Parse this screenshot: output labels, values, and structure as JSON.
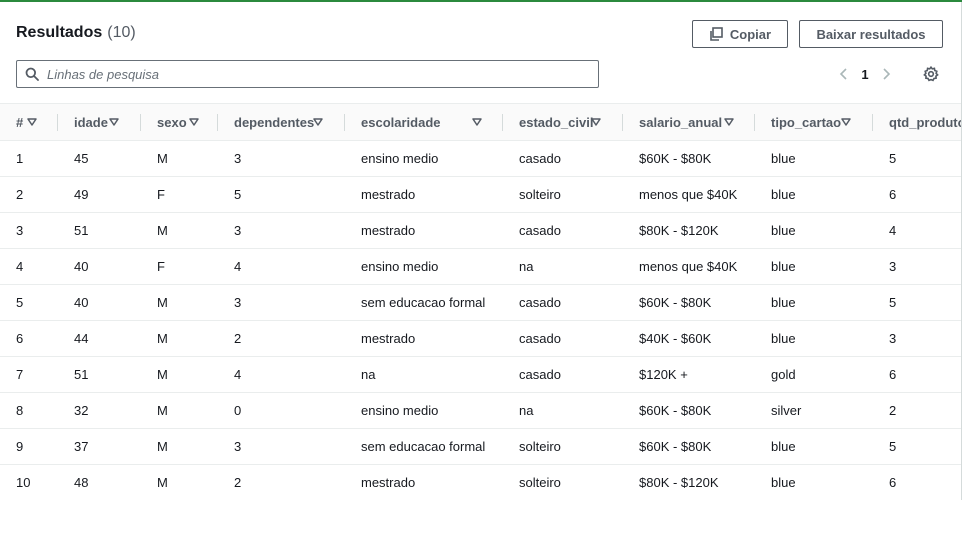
{
  "header": {
    "title": "Resultados",
    "count": "(10)"
  },
  "buttons": {
    "copy_label": "Copiar",
    "download_label": "Baixar resultados"
  },
  "search": {
    "placeholder": "Linhas de pesquisa",
    "value": ""
  },
  "pagination": {
    "current_page": "1"
  },
  "icons": {
    "copy": "copy-icon",
    "search": "search-icon",
    "prev": "chevron-left-icon",
    "next": "chevron-right-icon",
    "settings": "gear-icon",
    "sort": "sort-caret-down-icon"
  },
  "colors": {
    "top_accent": "#2b8a3e",
    "text": "#16191f",
    "muted": "#545b64",
    "border": "#eaeded"
  },
  "table": {
    "columns": [
      "#",
      "idade",
      "sexo",
      "dependentes",
      "escolaridade",
      "estado_civil",
      "salario_anual",
      "tipo_cartao",
      "qtd_produto"
    ],
    "rows": [
      [
        "1",
        "45",
        "M",
        "3",
        "ensino medio",
        "casado",
        "$60K - $80K",
        "blue",
        "5"
      ],
      [
        "2",
        "49",
        "F",
        "5",
        "mestrado",
        "solteiro",
        "menos que $40K",
        "blue",
        "6"
      ],
      [
        "3",
        "51",
        "M",
        "3",
        "mestrado",
        "casado",
        "$80K - $120K",
        "blue",
        "4"
      ],
      [
        "4",
        "40",
        "F",
        "4",
        "ensino medio",
        "na",
        "menos que $40K",
        "blue",
        "3"
      ],
      [
        "5",
        "40",
        "M",
        "3",
        "sem educacao formal",
        "casado",
        "$60K - $80K",
        "blue",
        "5"
      ],
      [
        "6",
        "44",
        "M",
        "2",
        "mestrado",
        "casado",
        "$40K - $60K",
        "blue",
        "3"
      ],
      [
        "7",
        "51",
        "M",
        "4",
        "na",
        "casado",
        "$120K +",
        "gold",
        "6"
      ],
      [
        "8",
        "32",
        "M",
        "0",
        "ensino medio",
        "na",
        "$60K - $80K",
        "silver",
        "2"
      ],
      [
        "9",
        "37",
        "M",
        "3",
        "sem educacao formal",
        "solteiro",
        "$60K - $80K",
        "blue",
        "5"
      ],
      [
        "10",
        "48",
        "M",
        "2",
        "mestrado",
        "solteiro",
        "$80K - $120K",
        "blue",
        "6"
      ]
    ]
  }
}
